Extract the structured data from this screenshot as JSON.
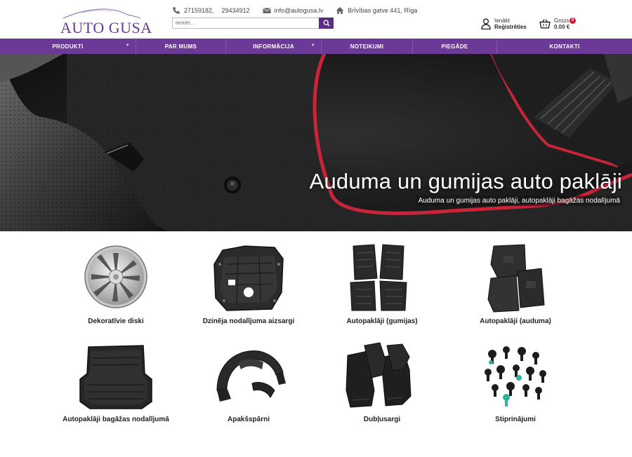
{
  "header": {
    "logo_text": "AUTO GUSA",
    "phone_1": "27159182,",
    "phone_2": "29434912",
    "email": "info@autogusa.lv",
    "address": "Brīvības gatve 441, Rīga",
    "search_placeholder": "Meklēt...",
    "account_login": "Ienākt",
    "account_register": "Reģistrēties",
    "cart_label": "Grozs",
    "cart_total": "0.00 €",
    "cart_count": "0"
  },
  "nav": [
    {
      "label": "PRODUKTI",
      "dropdown": true
    },
    {
      "label": "PAR MUMS",
      "dropdown": false
    },
    {
      "label": "INFORMĀCIJA",
      "dropdown": true
    },
    {
      "label": "NOTEIKUMI",
      "dropdown": false
    },
    {
      "label": "PIEGĀDE",
      "dropdown": false
    },
    {
      "label": "KONTAKTI",
      "dropdown": false
    }
  ],
  "hero": {
    "title": "Auduma un gumijas auto paklāji",
    "subtitle": "Auduma un gumijas auto paklāji, autopaklāji bagāžas nodalījumā"
  },
  "categories": [
    {
      "name": "Dekoratīvie diski",
      "icon": "wheel-cover-icon"
    },
    {
      "name": "Dzinēja nodalījuma aizsargi",
      "icon": "engine-guard-icon"
    },
    {
      "name": "Autopaklāji (gumijas)",
      "icon": "rubber-mats-icon"
    },
    {
      "name": "Autopaklāji (auduma)",
      "icon": "textile-mats-icon"
    },
    {
      "name": "Autopaklāji bagāžas nodalījumā",
      "icon": "trunk-mat-icon"
    },
    {
      "name": "Apakšspārni",
      "icon": "wheel-liner-icon"
    },
    {
      "name": "Dubļusargi",
      "icon": "mudflaps-icon"
    },
    {
      "name": "Stiprinājumi",
      "icon": "clips-icon"
    }
  ],
  "colors": {
    "brand_purple": "#6a3a96",
    "search_button": "#5b2d82",
    "badge_red": "#e0132b",
    "mat_trim_red": "#c8243a"
  }
}
